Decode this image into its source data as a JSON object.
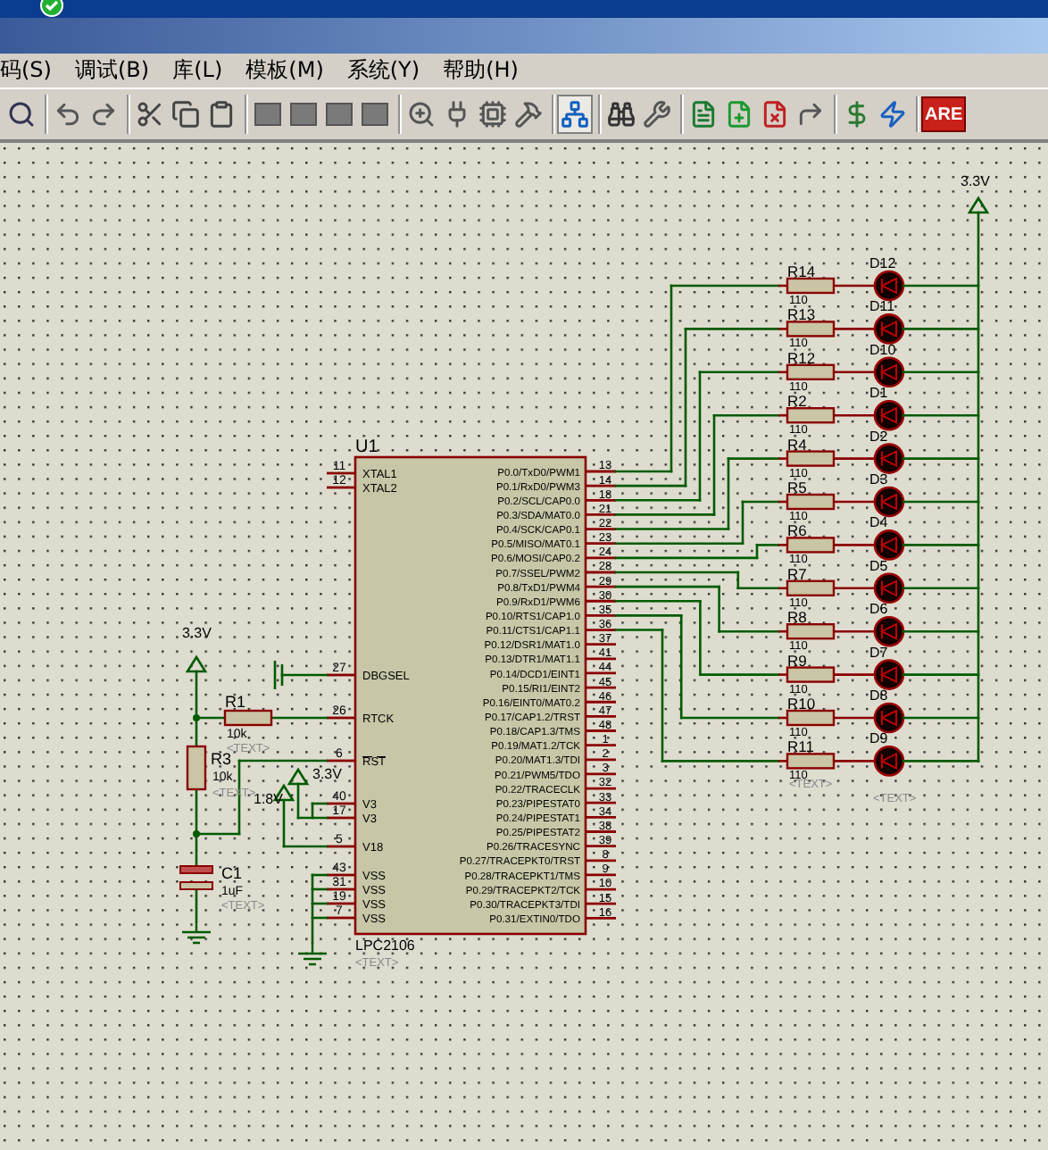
{
  "menu": [
    "码(S)",
    "调试(B)",
    "库(L)",
    "模板(M)",
    "系统(Y)",
    "帮助(H)"
  ],
  "toolbar": [
    [
      {
        "kind": "zoom-area",
        "selected": false
      }
    ],
    [
      {
        "kind": "undo",
        "selected": false
      },
      {
        "kind": "redo",
        "selected": false
      }
    ],
    [
      {
        "kind": "cut",
        "selected": false
      },
      {
        "kind": "copy",
        "selected": false
      },
      {
        "kind": "paste",
        "selected": false
      }
    ],
    [
      {
        "kind": "block-copy",
        "selected": false
      },
      {
        "kind": "block-move",
        "selected": false
      },
      {
        "kind": "block-rotate",
        "selected": false
      },
      {
        "kind": "block-delete",
        "selected": false
      }
    ],
    [
      {
        "kind": "zoom-pick",
        "selected": false
      },
      {
        "kind": "make-device",
        "selected": false
      },
      {
        "kind": "package",
        "selected": false
      },
      {
        "kind": "decompose",
        "selected": false
      }
    ],
    [
      {
        "kind": "netlist",
        "selected": true
      }
    ],
    [
      {
        "kind": "search",
        "selected": false
      },
      {
        "kind": "property",
        "selected": false
      }
    ],
    [
      {
        "kind": "sheet",
        "selected": false
      },
      {
        "kind": "new-sheet",
        "selected": false
      },
      {
        "kind": "delete-sheet",
        "selected": false
      },
      {
        "kind": "exit-sheet",
        "selected": false
      }
    ],
    [
      {
        "kind": "bom",
        "selected": false
      },
      {
        "kind": "erc",
        "selected": false
      }
    ],
    [
      {
        "kind": "ares",
        "selected": false,
        "label": "ARE"
      }
    ]
  ],
  "schematic": {
    "chip": {
      "ref": "U1",
      "part": "LPC2106",
      "text": "<TEXT>",
      "left_pins": [
        {
          "number": "11",
          "name": "XTAL1",
          "bar": false
        },
        {
          "number": "12",
          "name": "XTAL2",
          "bar": false
        },
        {
          "number": "27",
          "name": "DBGSEL",
          "bar": false
        },
        {
          "number": "26",
          "name": "RTCK",
          "bar": false
        },
        {
          "number": "6",
          "name": "RST",
          "bar": true
        },
        {
          "number": "40",
          "name": "V3",
          "bar": false
        },
        {
          "number": "17",
          "name": "V3",
          "bar": false
        },
        {
          "number": "5",
          "name": "V18",
          "bar": false
        },
        {
          "number": "43",
          "name": "VSS",
          "bar": false
        },
        {
          "number": "31",
          "name": "VSS",
          "bar": false
        },
        {
          "number": "19",
          "name": "VSS",
          "bar": false
        },
        {
          "number": "7",
          "name": "VSS",
          "bar": false
        }
      ],
      "right_pins": [
        {
          "number": "13",
          "name": "P0.0/TxD0/PWM1"
        },
        {
          "number": "14",
          "name": "P0.1/RxD0/PWM3"
        },
        {
          "number": "18",
          "name": "P0.2/SCL/CAP0.0"
        },
        {
          "number": "21",
          "name": "P0.3/SDA/MAT0.0"
        },
        {
          "number": "22",
          "name": "P0.4/SCK/CAP0.1"
        },
        {
          "number": "23",
          "name": "P0.5/MISO/MAT0.1"
        },
        {
          "number": "24",
          "name": "P0.6/MOSI/CAP0.2"
        },
        {
          "number": "28",
          "name": "P0.7/SSEL/PWM2"
        },
        {
          "number": "29",
          "name": "P0.8/TxD1/PWM4"
        },
        {
          "number": "30",
          "name": "P0.9/RxD1/PWM6"
        },
        {
          "number": "35",
          "name": "P0.10/RTS1/CAP1.0"
        },
        {
          "number": "36",
          "name": "P0.11/CTS1/CAP1.1"
        },
        {
          "number": "37",
          "name": "P0.12/DSR1/MAT1.0"
        },
        {
          "number": "41",
          "name": "P0.13/DTR1/MAT1.1"
        },
        {
          "number": "44",
          "name": "P0.14/DCD1/EINT1"
        },
        {
          "number": "45",
          "name": "P0.15/RI1/EINT2"
        },
        {
          "number": "46",
          "name": "P0.16/EINT0/MAT0.2"
        },
        {
          "number": "47",
          "name": "P0.17/CAP1.2/TRST"
        },
        {
          "number": "48",
          "name": "P0.18/CAP1.3/TMS"
        },
        {
          "number": "1",
          "name": "P0.19/MAT1.2/TCK"
        },
        {
          "number": "2",
          "name": "P0.20/MAT1.3/TDI"
        },
        {
          "number": "3",
          "name": "P0.21/PWM5/TDO"
        },
        {
          "number": "32",
          "name": "P0.22/TRACECLK"
        },
        {
          "number": "33",
          "name": "P0.23/PIPESTAT0"
        },
        {
          "number": "34",
          "name": "P0.24/PIPESTAT1"
        },
        {
          "number": "38",
          "name": "P0.25/PIPESTAT2"
        },
        {
          "number": "39",
          "name": "P0.26/TRACESYNC"
        },
        {
          "number": "8",
          "name": "P0.27/TRACEPKT0/TRST"
        },
        {
          "number": "9",
          "name": "P0.28/TRACEPKT1/TMS"
        },
        {
          "number": "10",
          "name": "P0.29/TRACEPKT2/TCK"
        },
        {
          "number": "15",
          "name": "P0.30/TRACEPKT3/TDI"
        },
        {
          "number": "16",
          "name": "P0.31/EXTIN0/TDO"
        }
      ]
    },
    "r1": {
      "ref": "R1",
      "value": "10k",
      "text": "<TEXT>"
    },
    "r3": {
      "ref": "R3",
      "value": "10k",
      "text": "<TEXT>"
    },
    "c1": {
      "ref": "C1",
      "value": "1uF",
      "text": "<TEXT>"
    },
    "power": [
      "3.3V",
      "3.3V",
      "1.8V",
      "3.3V"
    ],
    "led_rows": [
      {
        "resistor": "R14",
        "value": "110",
        "led": "D12"
      },
      {
        "resistor": "R13",
        "value": "110",
        "led": "D11"
      },
      {
        "resistor": "R12",
        "value": "110",
        "led": "D10"
      },
      {
        "resistor": "R2",
        "value": "110",
        "led": "D1"
      },
      {
        "resistor": "R4",
        "value": "110",
        "led": "D2"
      },
      {
        "resistor": "R5",
        "value": "110",
        "led": "D3"
      },
      {
        "resistor": "R6",
        "value": "110",
        "led": "D4"
      },
      {
        "resistor": "R7",
        "value": "110",
        "led": "D5"
      },
      {
        "resistor": "R8",
        "value": "110",
        "led": "D6"
      },
      {
        "resistor": "R9",
        "value": "110",
        "led": "D7"
      },
      {
        "resistor": "R10",
        "value": "110",
        "led": "D8"
      },
      {
        "resistor": "R11",
        "value": "110",
        "led": "D9"
      }
    ],
    "row_texts": [
      "<TEXT>",
      "<TEXT>"
    ]
  }
}
